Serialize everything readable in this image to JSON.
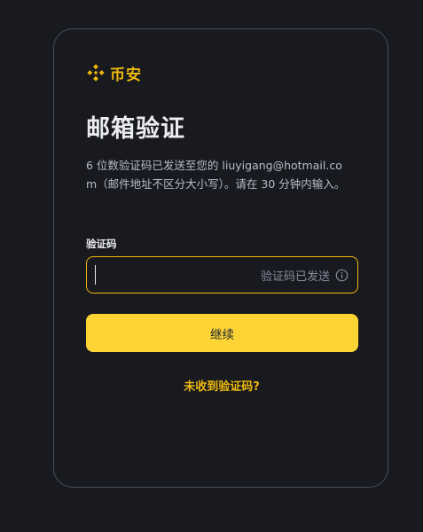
{
  "brand": {
    "name": "币安",
    "color": "#f0b90b"
  },
  "page": {
    "title": "邮箱验证",
    "description": "6 位数验证码已发送至您的 liuyigang@hotmail.com（邮件地址不区分大小写）。请在 30 分钟内输入。"
  },
  "code_field": {
    "label": "验证码",
    "value": "",
    "placeholder": "",
    "suffix_text": "验证码已发送",
    "suffix_icon": "info-icon"
  },
  "actions": {
    "continue_label": "继续",
    "resend_label": "未收到验证码?"
  },
  "colors": {
    "background": "#181a20",
    "border": "#474d57",
    "primary_button": "#fcd535",
    "input_focus_border": "#f0b90b",
    "muted_text": "#848e9c"
  }
}
